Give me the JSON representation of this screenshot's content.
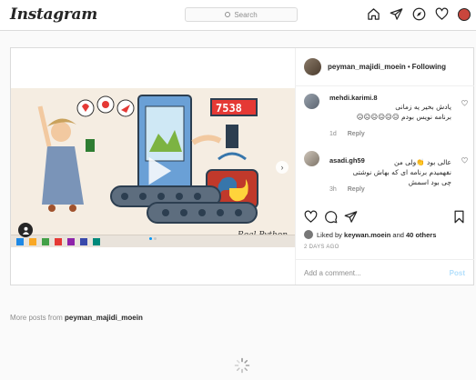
{
  "nav": {
    "logo": "Instagram",
    "search_placeholder": "Search",
    "icons": [
      "home-icon",
      "direct-icon",
      "explore-icon",
      "activity-heart-icon",
      "profile-avatar"
    ]
  },
  "post": {
    "username": "peyman_majidi_moein",
    "separator": "•",
    "follow_label": "Following",
    "media": {
      "watermark": "Real Python"
    },
    "comments": [
      {
        "username": "mehdi.karimi.8",
        "text_line1": "یادش بخیر یه زمانی",
        "text_line2": "برنامه نویس بودم 😑😑😑😑😑😑",
        "age": "1d",
        "reply": "Reply"
      },
      {
        "username": "asadi.gh59",
        "text_line1": "عالی بود 👏ولی من",
        "text_line2": "نفهمیدم برنامه ای که بهاش نوشتی",
        "text_line3": "چی بود اسمش",
        "age": "3h",
        "reply": "Reply"
      }
    ],
    "liked_prefix": "Liked by",
    "liked_user": "keywan.moein",
    "liked_and": "and",
    "liked_others": "40 others",
    "date": "2 DAYS AGO",
    "add_comment_placeholder": "Add a comment...",
    "post_label": "Post"
  },
  "more_posts": {
    "prefix": "More posts from",
    "username": "peyman_majidi_moein"
  },
  "colors": {
    "accent": "#0095f6",
    "border": "#dbdbdb",
    "muted": "#8e8e8e"
  }
}
